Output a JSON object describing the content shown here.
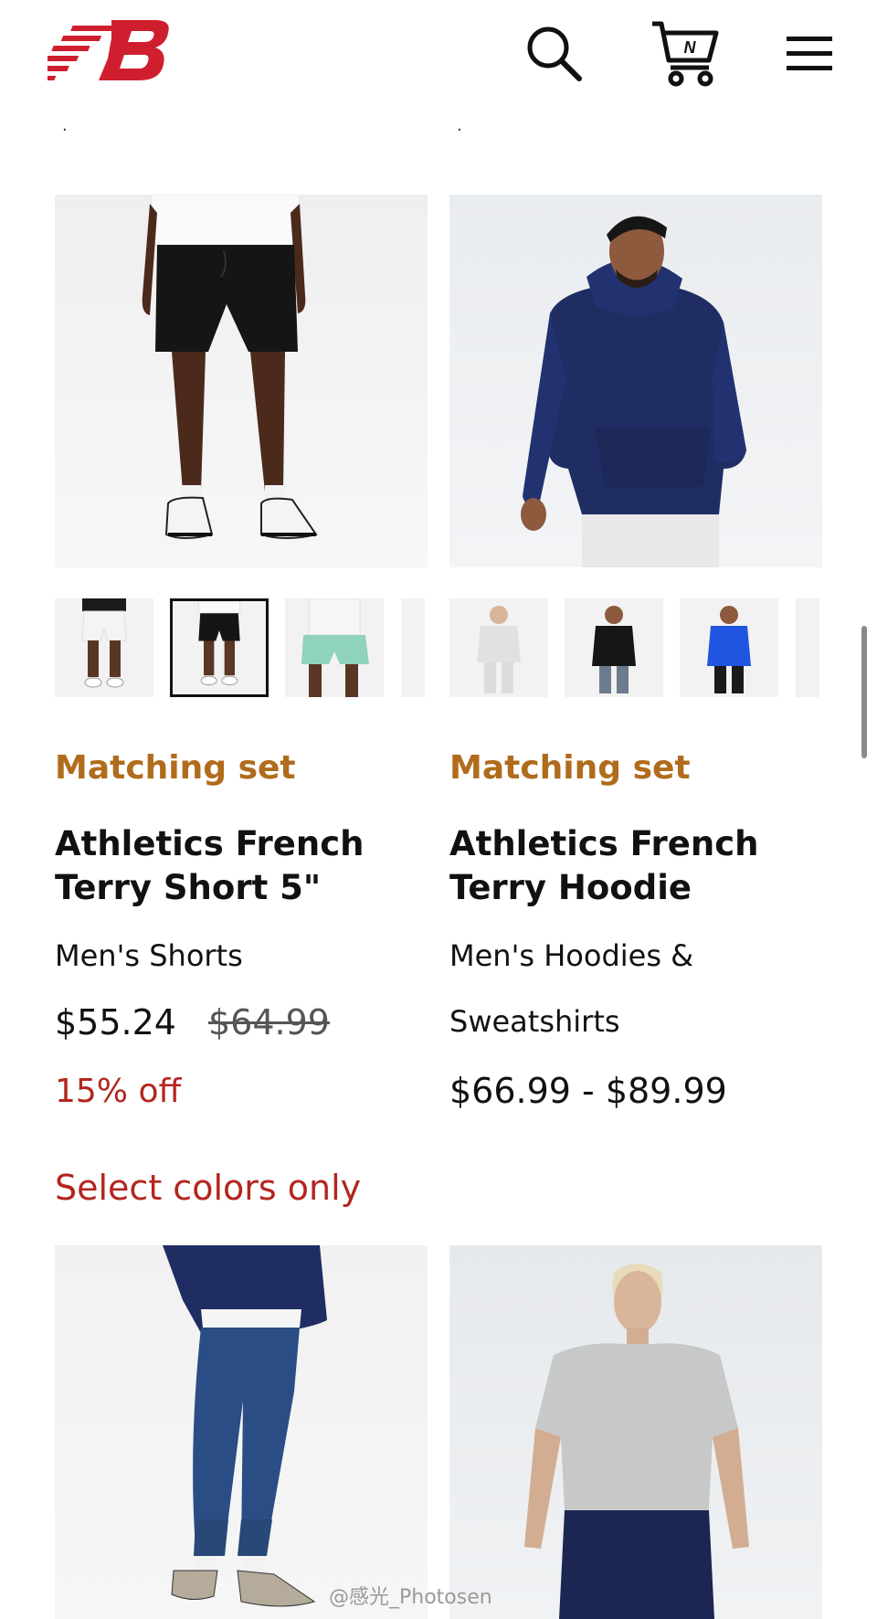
{
  "header": {
    "logo_text": "NB",
    "icons": [
      "search-icon",
      "cart-icon",
      "menu-icon"
    ],
    "cart_letter": "N"
  },
  "colors": {
    "brand_red": "#cf1f2e",
    "badge_orange": "#b06c1c",
    "sale_red": "#b3261e",
    "text": "#111111"
  },
  "products": [
    {
      "badge": "Matching set",
      "name": "Athletics French Terry Short 5\"",
      "category": "Men's Shorts",
      "price": "$55.24",
      "original_price": "$64.99",
      "discount": "15% off",
      "note": "Select colors only",
      "swatches": [
        "white",
        "black",
        "mint"
      ],
      "selected_swatch": 1
    },
    {
      "badge": "Matching set",
      "name": "Athletics French Terry Hoodie",
      "category": "Men's Hoodies & Sweatshirts",
      "price": "$66.99 - $89.99",
      "swatches": [
        "light-grey",
        "black",
        "royal-blue"
      ]
    }
  ],
  "watermark": "@感光_Photosen"
}
